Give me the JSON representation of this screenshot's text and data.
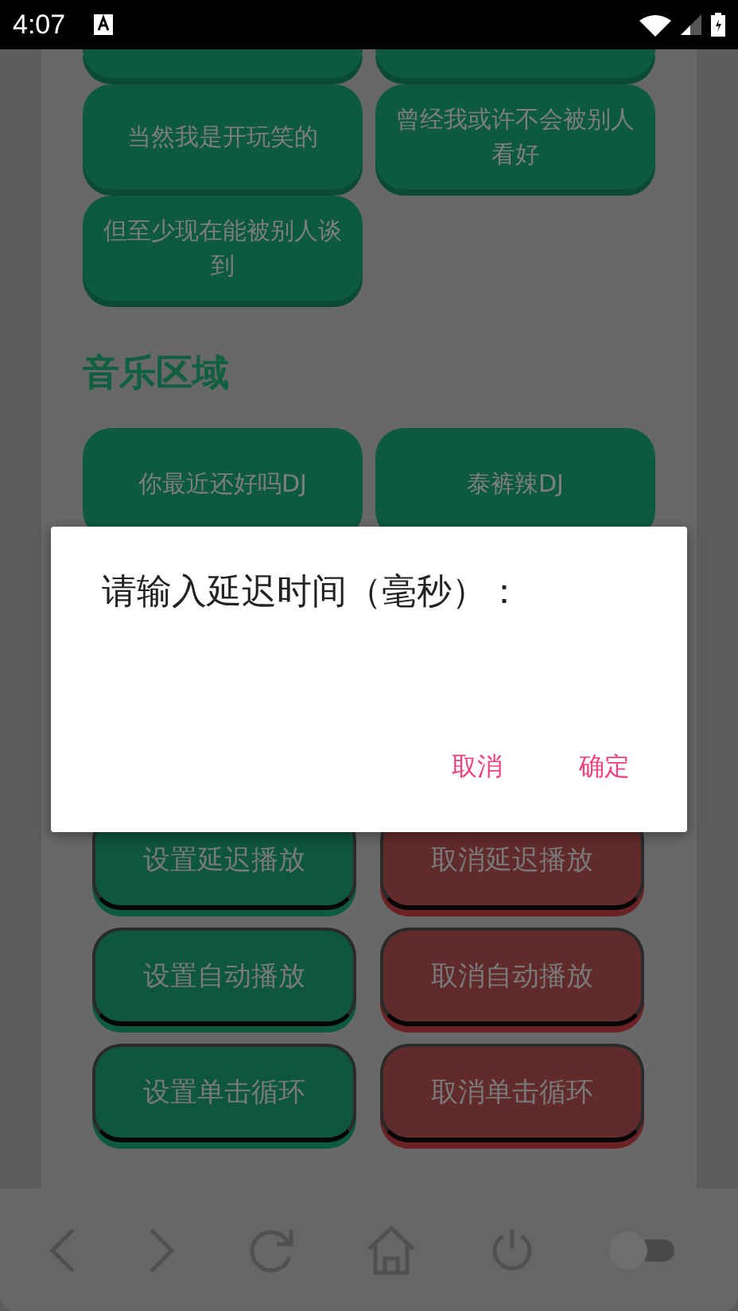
{
  "status_bar": {
    "time": "4:07"
  },
  "song_buttons": [
    {
      "kind": "cut"
    },
    {
      "kind": "cut"
    },
    {
      "kind": "full",
      "label": "当然我是开玩笑的"
    },
    {
      "kind": "full",
      "label": "曾经我或许不会被别人看好"
    },
    {
      "kind": "full",
      "label": "但至少现在能被别人谈到"
    }
  ],
  "music_section": {
    "title": "音乐区域",
    "buttons": [
      {
        "label": "你最近还好吗DJ"
      },
      {
        "label": "泰裤辣DJ"
      }
    ]
  },
  "controls": [
    {
      "kind": "set",
      "label": "设置延迟播放"
    },
    {
      "kind": "cancel",
      "label": "取消延迟播放"
    },
    {
      "kind": "set",
      "label": "设置自动播放"
    },
    {
      "kind": "cancel",
      "label": "取消自动播放"
    },
    {
      "kind": "set",
      "label": "设置单击循环"
    },
    {
      "kind": "cancel",
      "label": "取消单击循环"
    }
  ],
  "dialog": {
    "title": "请输入延迟时间（毫秒）：",
    "buttons": [
      "取消",
      "确定"
    ]
  },
  "bottom_bar": {
    "toggle": {
      "on": false
    }
  }
}
